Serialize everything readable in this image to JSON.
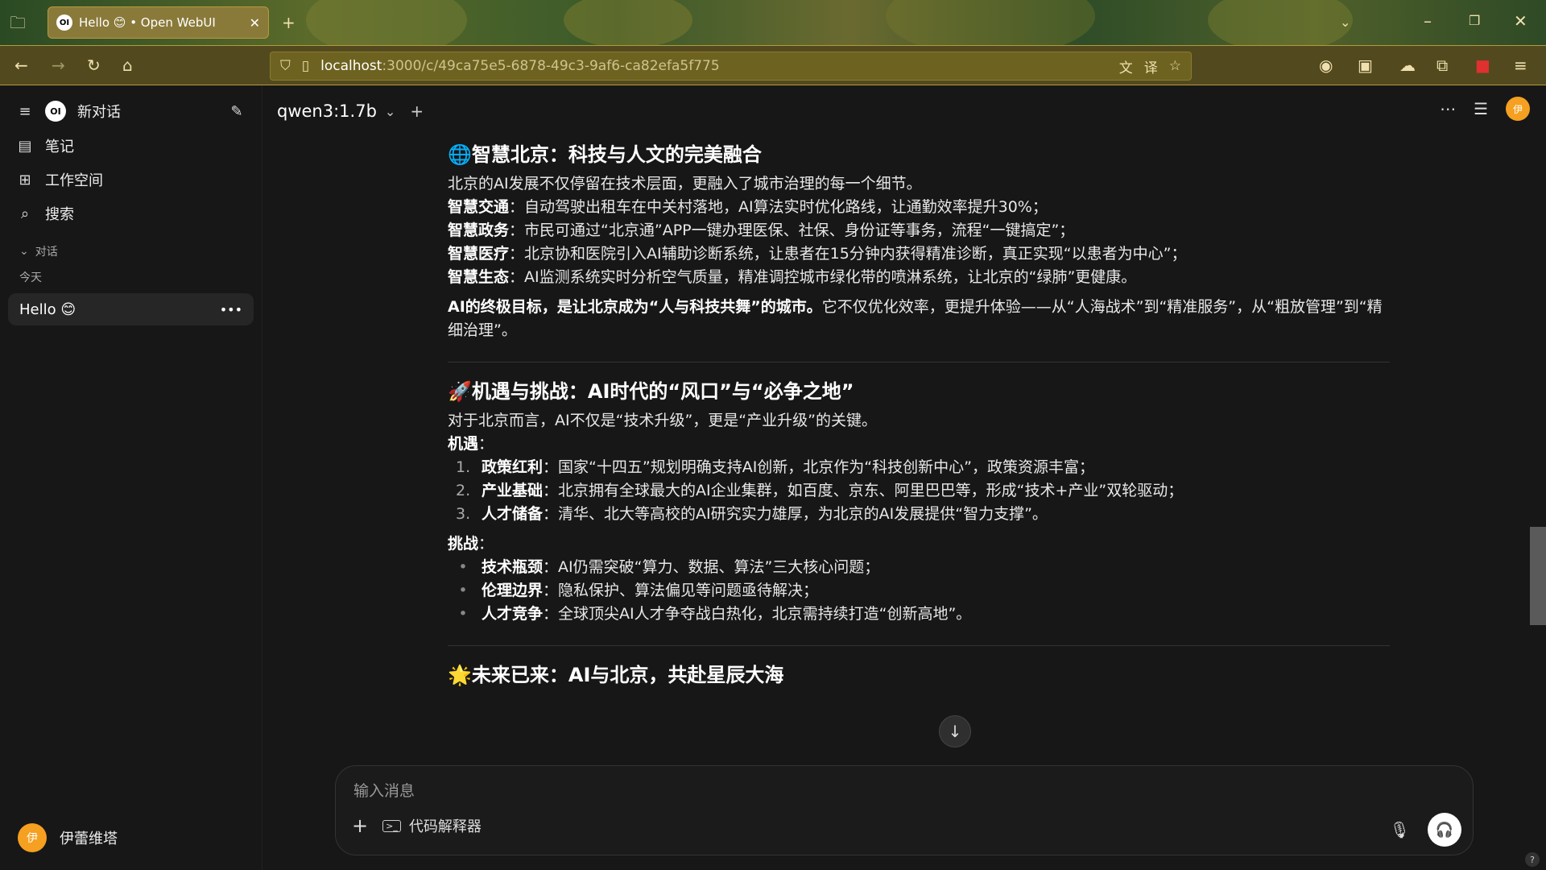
{
  "browser": {
    "tab_title": "Hello 😊 • Open WebUI",
    "favicon_text": "OI",
    "url_host": "localhost",
    "url_path": ":3000/c/49ca75e5-6878-49c3-9af6-ca82efa5f775"
  },
  "sidebar": {
    "new_chat": "新对话",
    "items": [
      {
        "label": "笔记",
        "icon": "notebook-icon"
      },
      {
        "label": "工作空间",
        "icon": "grid-icon"
      },
      {
        "label": "搜索",
        "icon": "search-icon"
      }
    ],
    "section_label": "对话",
    "date_group": "今天",
    "chat_title": "Hello 😊",
    "user_name": "伊蕾维塔",
    "user_initial": "伊"
  },
  "header": {
    "model": "qwen3:1.7b",
    "user_initial": "伊"
  },
  "message": {
    "s1_title": "🌐智慧北京：科技与人文的完美融合",
    "s1_intro": "北京的AI发展不仅停留在技术层面，更融入了城市治理的每一个细节。",
    "s1_items": [
      {
        "bold": "智慧交通",
        "text": "：自动驾驶出租车在中关村落地，AI算法实时优化路线，让通勤效率提升30%；"
      },
      {
        "bold": "智慧政务",
        "text": "：市民可通过“北京通”APP一键办理医保、社保、身份证等事务，流程“一键搞定”；"
      },
      {
        "bold": "智慧医疗",
        "text": "：北京协和医院引入AI辅助诊断系统，让患者在15分钟内获得精准诊断，真正实现“以患者为中心”；"
      },
      {
        "bold": "智慧生态",
        "text": "：AI监测系统实时分析空气质量，精准调控城市绿化带的喷淋系统，让北京的“绿肺”更健康。"
      }
    ],
    "s1_conclusion_bold": "AI的终极目标，是让北京成为“人与科技共舞”的城市。",
    "s1_conclusion_text": "它不仅优化效率，更提升体验——从“人海战术”到“精准服务”，从“粗放管理”到“精细治理”。",
    "s2_title": "🚀机遇与挑战：AI时代的“风口”与“必争之地”",
    "s2_intro": "对于北京而言，AI不仅是“技术升级”，更是“产业升级”的关键。",
    "s2_opp_label": "机遇",
    "s2_colon": "：",
    "s2_opps": [
      {
        "num": "1.",
        "bold": "政策红利",
        "text": "：国家“十四五”规划明确支持AI创新，北京作为“科技创新中心”，政策资源丰富；"
      },
      {
        "num": "2.",
        "bold": "产业基础",
        "text": "：北京拥有全球最大的AI企业集群，如百度、京东、阿里巴巴等，形成“技术+产业”双轮驱动；"
      },
      {
        "num": "3.",
        "bold": "人才储备",
        "text": "：清华、北大等高校的AI研究实力雄厚，为北京的AI发展提供“智力支撑”。"
      }
    ],
    "s2_chal_label": "挑战",
    "s2_chals": [
      {
        "bold": "技术瓶颈",
        "text": "：AI仍需突破“算力、数据、算法”三大核心问题；"
      },
      {
        "bold": "伦理边界",
        "text": "：隐私保护、算法偏见等问题亟待解决；"
      },
      {
        "bold": "人才竞争",
        "text": "：全球顶尖AI人才争夺战白热化，北京需持续打造“创新高地”。"
      }
    ],
    "s3_title": "🌟未来已来：AI与北京，共赴星辰大海"
  },
  "composer": {
    "placeholder": "输入消息",
    "code_interpreter": "代码解释器"
  }
}
